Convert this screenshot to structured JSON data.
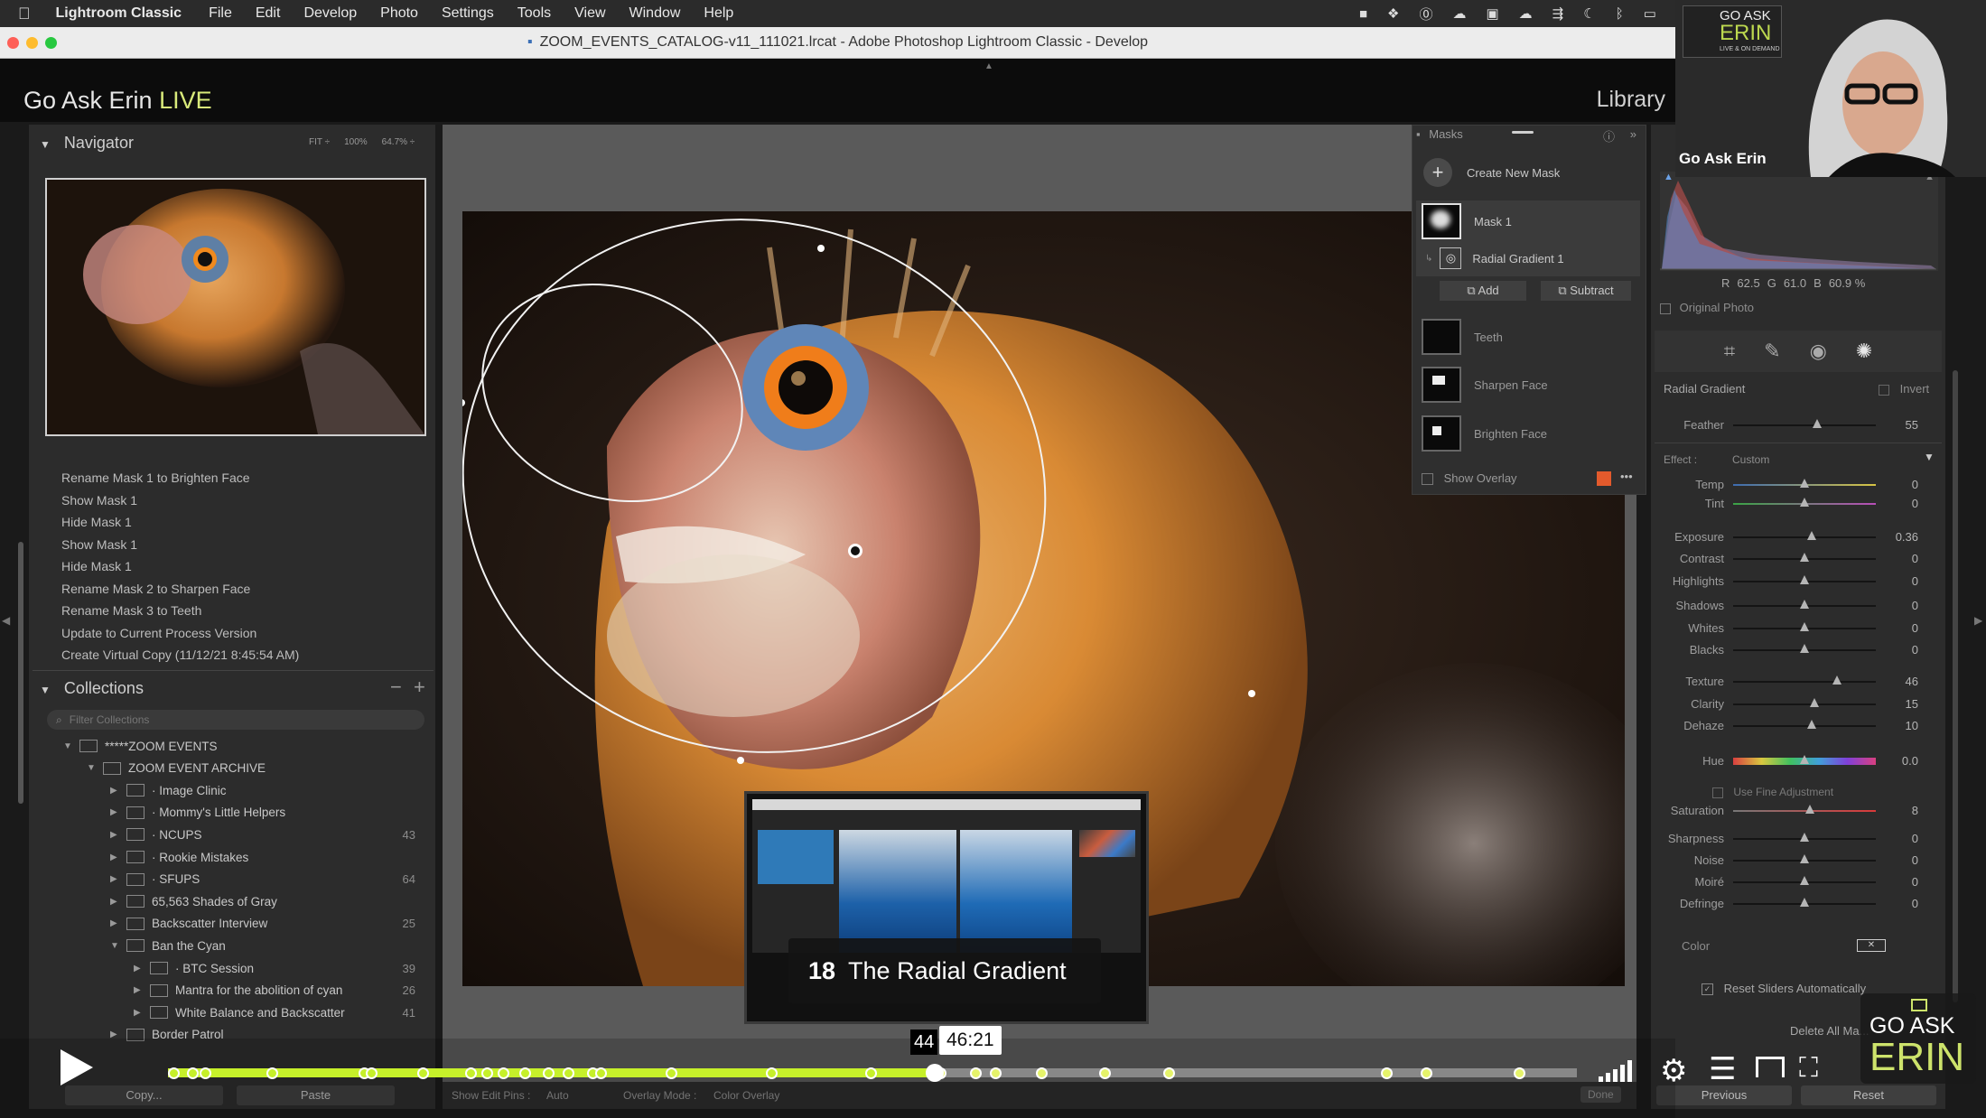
{
  "menubar": {
    "app_name": "Lightroom Classic",
    "items": [
      "File",
      "Edit",
      "Develop",
      "Photo",
      "Settings",
      "Tools",
      "View",
      "Window",
      "Help"
    ]
  },
  "window": {
    "title": "ZOOM_EVENTS_CATALOG-v11_111021.lrcat - Adobe Photoshop Lightroom Classic - Develop"
  },
  "header": {
    "brand": "Go Ask Erin",
    "brand_live": "LIVE",
    "module": "Library"
  },
  "navigator": {
    "title": "Navigator",
    "zoom_options": [
      "FIT ÷",
      "100%",
      "64.7% ÷"
    ]
  },
  "history": [
    "Rename Mask 1 to Brighten Face",
    "Show Mask 1",
    "Hide Mask 1",
    "Show Mask 1",
    "Hide Mask 1",
    "Rename Mask 2 to Sharpen Face",
    "Rename Mask 3 to Teeth",
    "Update to Current Process Version",
    "Create Virtual Copy (11/12/21 8:45:54 AM)"
  ],
  "collections": {
    "title": "Collections",
    "filter_placeholder": "Filter Collections",
    "items": [
      {
        "label": "*****ZOOM EVENTS",
        "count": "",
        "indent": 0,
        "tri": "▼"
      },
      {
        "label": "ZOOM EVENT ARCHIVE",
        "count": "",
        "indent": 1,
        "tri": "▼"
      },
      {
        "label": "· Image Clinic",
        "count": "",
        "indent": 2,
        "tri": "▶"
      },
      {
        "label": "· Mommy's Little Helpers",
        "count": "",
        "indent": 2,
        "tri": "▶"
      },
      {
        "label": "· NCUPS",
        "count": "43",
        "indent": 2,
        "tri": "▶"
      },
      {
        "label": "· Rookie Mistakes",
        "count": "",
        "indent": 2,
        "tri": "▶"
      },
      {
        "label": "· SFUPS",
        "count": "64",
        "indent": 2,
        "tri": "▶"
      },
      {
        "label": "65,563 Shades of Gray",
        "count": "",
        "indent": 2,
        "tri": "▶"
      },
      {
        "label": "Backscatter Interview",
        "count": "25",
        "indent": 2,
        "tri": "▶"
      },
      {
        "label": "Ban the Cyan",
        "count": "",
        "indent": 2,
        "tri": "▼"
      },
      {
        "label": "· BTC Session",
        "count": "39",
        "indent": 3,
        "tri": "▶"
      },
      {
        "label": "Mantra for the abolition of cyan",
        "count": "26",
        "indent": 3,
        "tri": "▶"
      },
      {
        "label": "White Balance and Backscatter",
        "count": "41",
        "indent": 3,
        "tri": "▶"
      },
      {
        "label": "Border Patrol",
        "count": "",
        "indent": 2,
        "tri": "▶"
      }
    ]
  },
  "left_footer": {
    "copy": "Copy...",
    "paste": "Paste"
  },
  "toolbar_bottom": {
    "show_edit_pins": "Show Edit Pins :",
    "auto": "Auto",
    "overlay_mode": "Overlay Mode :",
    "color_overlay": "Color Overlay",
    "done": "Done"
  },
  "masks": {
    "title": "Masks",
    "create_new": "Create New Mask",
    "items": [
      {
        "label": "Mask 1"
      },
      {
        "label": "Radial Gradient 1"
      },
      {
        "label": "Teeth"
      },
      {
        "label": "Sharpen Face"
      },
      {
        "label": "Brighten Face"
      }
    ],
    "add": "Add",
    "subtract": "Subtract",
    "show_overlay": "Show Overlay",
    "overlay_color": "#e35a2c"
  },
  "histogram": {
    "r_label": "R",
    "r": "62.5",
    "g_label": "G",
    "g": "61.0",
    "b_label": "B",
    "b": "60.9 %",
    "original_photo": "Original Photo"
  },
  "radial": {
    "title": "Radial Gradient",
    "invert": "Invert",
    "feather_label": "Feather",
    "feather": "55",
    "effect_label": "Effect :",
    "effect_value": "Custom"
  },
  "sliders": [
    {
      "label": "Temp",
      "value": "0",
      "pos": 0.5
    },
    {
      "label": "Tint",
      "value": "0",
      "pos": 0.5
    },
    {
      "label": "Exposure",
      "value": "0.36",
      "pos": 0.55
    },
    {
      "label": "Contrast",
      "value": "0",
      "pos": 0.5
    },
    {
      "label": "Highlights",
      "value": "0",
      "pos": 0.5
    },
    {
      "label": "Shadows",
      "value": "0",
      "pos": 0.5
    },
    {
      "label": "Whites",
      "value": "0",
      "pos": 0.5
    },
    {
      "label": "Blacks",
      "value": "0",
      "pos": 0.5
    },
    {
      "label": "Texture",
      "value": "46",
      "pos": 0.73
    },
    {
      "label": "Clarity",
      "value": "15",
      "pos": 0.57
    },
    {
      "label": "Dehaze",
      "value": "10",
      "pos": 0.55
    },
    {
      "label": "Hue",
      "value": "0.0",
      "pos": 0.5
    },
    {
      "label": "Saturation",
      "value": "8",
      "pos": 0.54
    },
    {
      "label": "Sharpness",
      "value": "0",
      "pos": 0.5
    },
    {
      "label": "Noise",
      "value": "0",
      "pos": 0.5
    },
    {
      "label": "Moiré",
      "value": "0",
      "pos": 0.5
    },
    {
      "label": "Defringe",
      "value": "0",
      "pos": 0.5
    }
  ],
  "fine_adjustment": "Use Fine Adjustment",
  "color_label": "Color",
  "reset_sliders": "Reset Sliders Automatically",
  "delete_all": "Delete All Ma...",
  "footer_right": {
    "previous": "Previous",
    "reset": "Reset"
  },
  "video": {
    "chapter_number": "18",
    "chapter_title": "The Radial Gradient",
    "time_hover": "46:21",
    "time_partial": "44",
    "progress": 0.544,
    "accent": "#c6f02a"
  },
  "webcam": {
    "name": "Go Ask Erin",
    "logo_top": "GO ASK",
    "logo_main": "ERIN",
    "logo_sub": "LIVE & ON DEMAND"
  },
  "watermark": {
    "top": "GO ASK",
    "main": "ERIN"
  }
}
